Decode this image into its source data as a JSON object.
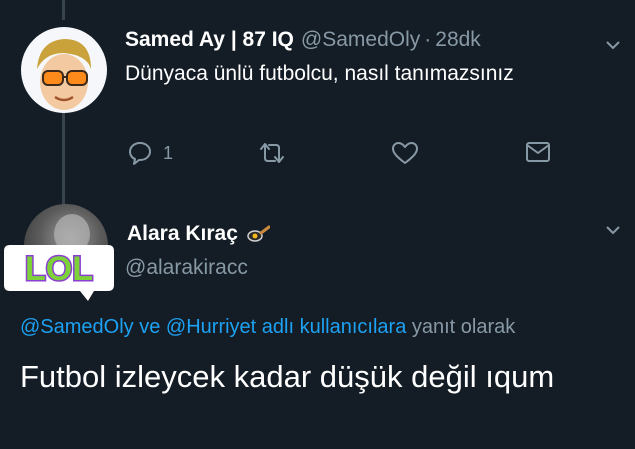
{
  "tweet1": {
    "author_name": "Samed Ay | 87 IQ",
    "handle": "@SamedOly",
    "separator": "·",
    "time": "28dk",
    "text": "Dünyaca ünlü futbolcu, nasıl tanımazsınız",
    "reply_count": "1",
    "icons": [
      "reply-icon",
      "retweet-icon",
      "like-icon",
      "direct-message-icon",
      "chevron-down-icon"
    ]
  },
  "tweet2": {
    "author_name": "Alara Kıraç",
    "name_emoji": "frying-pan-emoji",
    "handle": "@alarakiracc",
    "replying_mention1": "@SamedOly",
    "replying_and": "ve",
    "replying_mention2": "@Hurriyet adlı kullanıcılara",
    "replying_suffix": "yanıt olarak",
    "text": "Futbol izleycek kadar düşük değil ıqum",
    "sticker_text": "LOL"
  },
  "colors": {
    "background": "#141d26",
    "text": "#ffffff",
    "muted": "#8899a6",
    "link": "#1da1f2",
    "sticker_purple": "#8a3fd1",
    "sticker_green": "#7dd23a"
  }
}
